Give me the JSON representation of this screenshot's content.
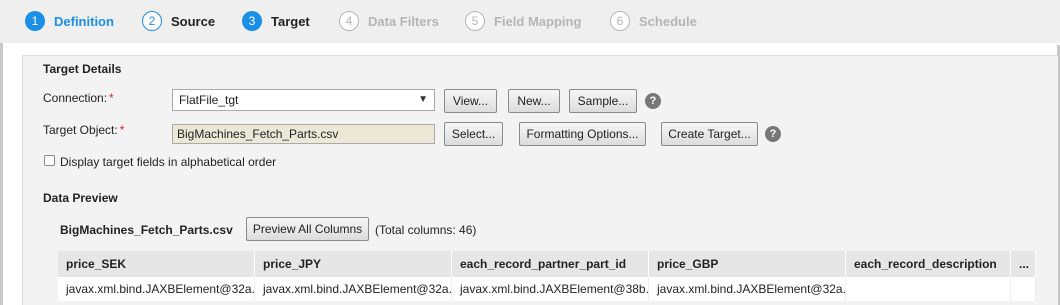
{
  "steps": [
    {
      "num": "1",
      "label": "Definition"
    },
    {
      "num": "2",
      "label": "Source"
    },
    {
      "num": "3",
      "label": "Target"
    },
    {
      "num": "4",
      "label": "Data Filters"
    },
    {
      "num": "5",
      "label": "Field Mapping"
    },
    {
      "num": "6",
      "label": "Schedule"
    }
  ],
  "target_details": {
    "title": "Target Details",
    "connection_label": "Connection:",
    "required_marker": "*",
    "connection_value": "FlatFile_tgt",
    "view_button": "View...",
    "new_button": "New...",
    "sample_button": "Sample...",
    "help_glyph": "?",
    "target_object_label": "Target Object:",
    "target_object_value": "BigMachines_Fetch_Parts.csv",
    "select_button": "Select...",
    "formatting_button": "Formatting Options...",
    "create_target_button": "Create Target...",
    "alphabetical_label": "Display target fields in alphabetical order"
  },
  "data_preview": {
    "title": "Data Preview",
    "file_name": "BigMachines_Fetch_Parts.csv",
    "preview_all_button": "Preview All Columns",
    "total_columns": "(Total columns: 46)",
    "columns": [
      "price_SEK",
      "price_JPY",
      "each_record_partner_part_id",
      "price_GBP",
      "each_record_description",
      "..."
    ],
    "rows": [
      [
        "javax.xml.bind.JAXBElement@32a...",
        "javax.xml.bind.JAXBElement@32a...",
        "javax.xml.bind.JAXBElement@38b...",
        "javax.xml.bind.JAXBElement@32a...",
        "",
        ""
      ]
    ]
  },
  "colors": {
    "accent": "#1b8fe6",
    "disabled": "#b5b5b5",
    "required": "#dd2222"
  }
}
